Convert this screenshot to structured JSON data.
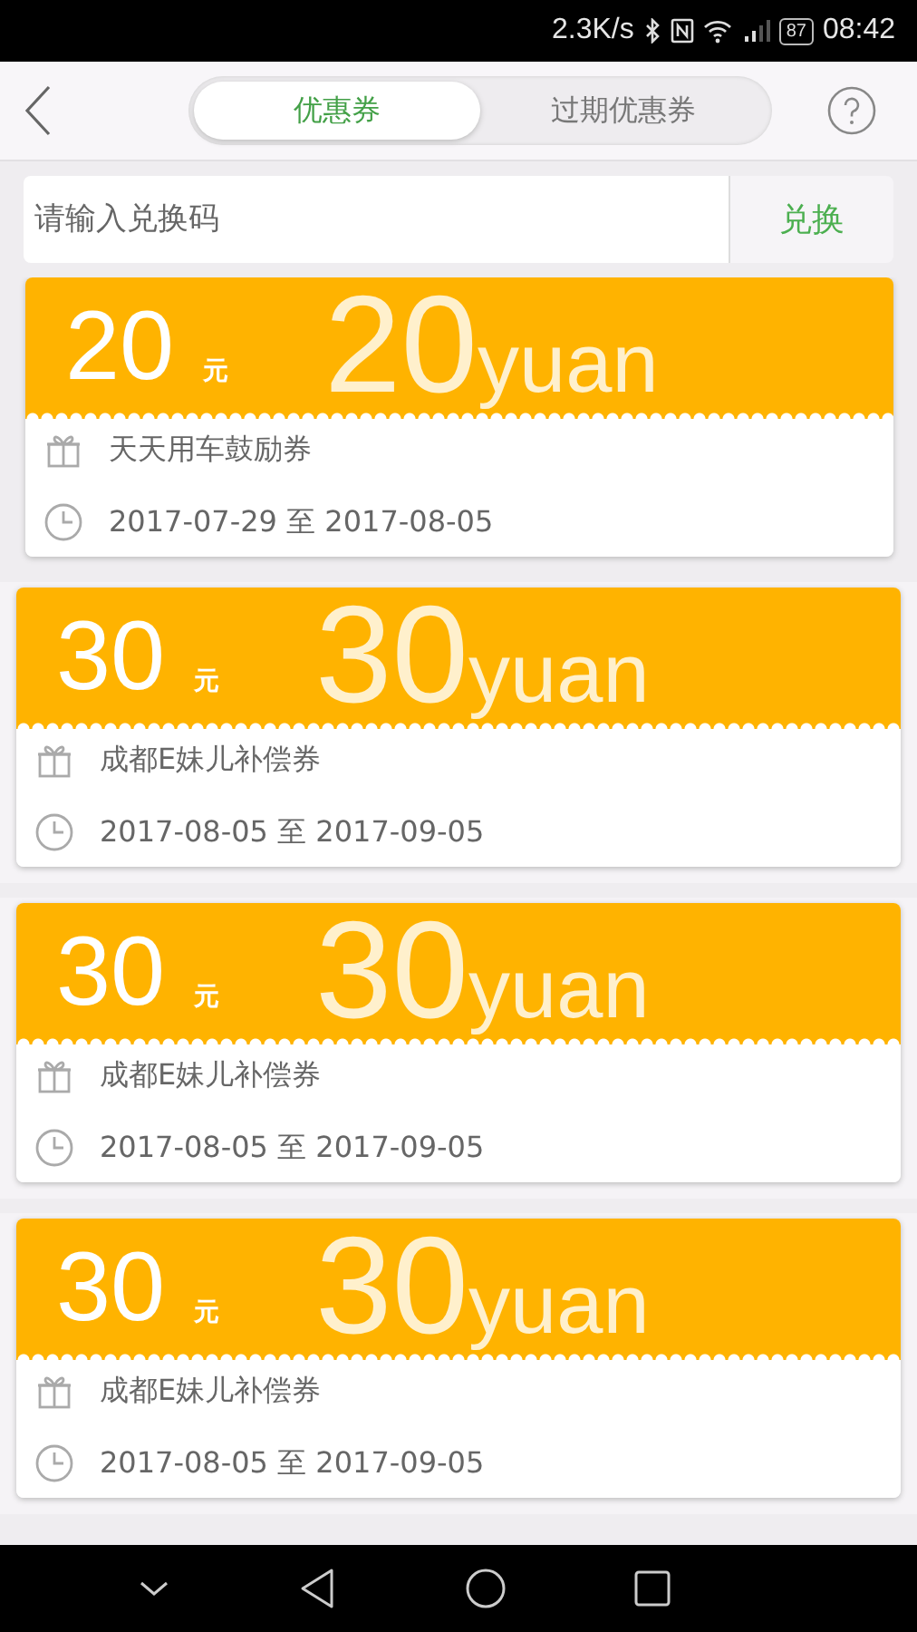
{
  "status_bar": {
    "speed": "2.3K/s",
    "battery": "87",
    "time": "08:42"
  },
  "header": {
    "tabs": [
      {
        "label": "优惠券",
        "selected": true
      },
      {
        "label": "过期优惠券",
        "selected": false
      }
    ]
  },
  "redeem": {
    "placeholder": "请输入兑换码",
    "button": "兑换"
  },
  "coupons": [
    {
      "amount": "20",
      "unit": "元",
      "bg_amount": "20",
      "bg_unit": "yuan",
      "name": "天天用车鼓励券",
      "period": "2017-07-29 至 2017-08-05"
    },
    {
      "amount": "30",
      "unit": "元",
      "bg_amount": "30",
      "bg_unit": "yuan",
      "name": "成都E妹儿补偿券",
      "period": "2017-08-05 至 2017-09-05"
    },
    {
      "amount": "30",
      "unit": "元",
      "bg_amount": "30",
      "bg_unit": "yuan",
      "name": "成都E妹儿补偿券",
      "period": "2017-08-05 至 2017-09-05"
    },
    {
      "amount": "30",
      "unit": "元",
      "bg_amount": "30",
      "bg_unit": "yuan",
      "name": "成都E妹儿补偿券",
      "period": "2017-08-05 至 2017-09-05"
    }
  ]
}
